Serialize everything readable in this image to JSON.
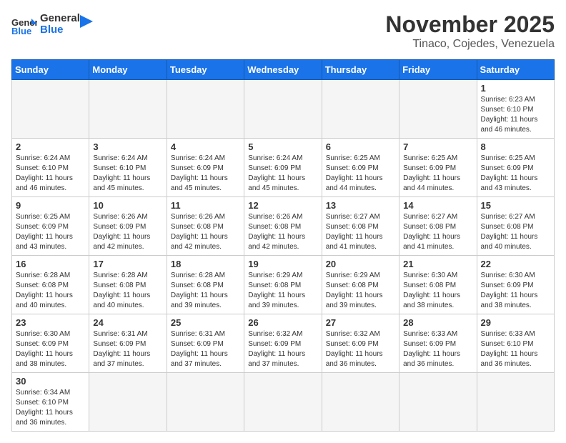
{
  "logo": {
    "text_general": "General",
    "text_blue": "Blue"
  },
  "header": {
    "month_title": "November 2025",
    "subtitle": "Tinaco, Cojedes, Venezuela"
  },
  "weekdays": [
    "Sunday",
    "Monday",
    "Tuesday",
    "Wednesday",
    "Thursday",
    "Friday",
    "Saturday"
  ],
  "weeks": [
    [
      {
        "day": "",
        "info": ""
      },
      {
        "day": "",
        "info": ""
      },
      {
        "day": "",
        "info": ""
      },
      {
        "day": "",
        "info": ""
      },
      {
        "day": "",
        "info": ""
      },
      {
        "day": "",
        "info": ""
      },
      {
        "day": "1",
        "info": "Sunrise: 6:23 AM\nSunset: 6:10 PM\nDaylight: 11 hours and 46 minutes."
      }
    ],
    [
      {
        "day": "2",
        "info": "Sunrise: 6:24 AM\nSunset: 6:10 PM\nDaylight: 11 hours and 46 minutes."
      },
      {
        "day": "3",
        "info": "Sunrise: 6:24 AM\nSunset: 6:10 PM\nDaylight: 11 hours and 45 minutes."
      },
      {
        "day": "4",
        "info": "Sunrise: 6:24 AM\nSunset: 6:09 PM\nDaylight: 11 hours and 45 minutes."
      },
      {
        "day": "5",
        "info": "Sunrise: 6:24 AM\nSunset: 6:09 PM\nDaylight: 11 hours and 45 minutes."
      },
      {
        "day": "6",
        "info": "Sunrise: 6:25 AM\nSunset: 6:09 PM\nDaylight: 11 hours and 44 minutes."
      },
      {
        "day": "7",
        "info": "Sunrise: 6:25 AM\nSunset: 6:09 PM\nDaylight: 11 hours and 44 minutes."
      },
      {
        "day": "8",
        "info": "Sunrise: 6:25 AM\nSunset: 6:09 PM\nDaylight: 11 hours and 43 minutes."
      }
    ],
    [
      {
        "day": "9",
        "info": "Sunrise: 6:25 AM\nSunset: 6:09 PM\nDaylight: 11 hours and 43 minutes."
      },
      {
        "day": "10",
        "info": "Sunrise: 6:26 AM\nSunset: 6:09 PM\nDaylight: 11 hours and 42 minutes."
      },
      {
        "day": "11",
        "info": "Sunrise: 6:26 AM\nSunset: 6:08 PM\nDaylight: 11 hours and 42 minutes."
      },
      {
        "day": "12",
        "info": "Sunrise: 6:26 AM\nSunset: 6:08 PM\nDaylight: 11 hours and 42 minutes."
      },
      {
        "day": "13",
        "info": "Sunrise: 6:27 AM\nSunset: 6:08 PM\nDaylight: 11 hours and 41 minutes."
      },
      {
        "day": "14",
        "info": "Sunrise: 6:27 AM\nSunset: 6:08 PM\nDaylight: 11 hours and 41 minutes."
      },
      {
        "day": "15",
        "info": "Sunrise: 6:27 AM\nSunset: 6:08 PM\nDaylight: 11 hours and 40 minutes."
      }
    ],
    [
      {
        "day": "16",
        "info": "Sunrise: 6:28 AM\nSunset: 6:08 PM\nDaylight: 11 hours and 40 minutes."
      },
      {
        "day": "17",
        "info": "Sunrise: 6:28 AM\nSunset: 6:08 PM\nDaylight: 11 hours and 40 minutes."
      },
      {
        "day": "18",
        "info": "Sunrise: 6:28 AM\nSunset: 6:08 PM\nDaylight: 11 hours and 39 minutes."
      },
      {
        "day": "19",
        "info": "Sunrise: 6:29 AM\nSunset: 6:08 PM\nDaylight: 11 hours and 39 minutes."
      },
      {
        "day": "20",
        "info": "Sunrise: 6:29 AM\nSunset: 6:08 PM\nDaylight: 11 hours and 39 minutes."
      },
      {
        "day": "21",
        "info": "Sunrise: 6:30 AM\nSunset: 6:08 PM\nDaylight: 11 hours and 38 minutes."
      },
      {
        "day": "22",
        "info": "Sunrise: 6:30 AM\nSunset: 6:09 PM\nDaylight: 11 hours and 38 minutes."
      }
    ],
    [
      {
        "day": "23",
        "info": "Sunrise: 6:30 AM\nSunset: 6:09 PM\nDaylight: 11 hours and 38 minutes."
      },
      {
        "day": "24",
        "info": "Sunrise: 6:31 AM\nSunset: 6:09 PM\nDaylight: 11 hours and 37 minutes."
      },
      {
        "day": "25",
        "info": "Sunrise: 6:31 AM\nSunset: 6:09 PM\nDaylight: 11 hours and 37 minutes."
      },
      {
        "day": "26",
        "info": "Sunrise: 6:32 AM\nSunset: 6:09 PM\nDaylight: 11 hours and 37 minutes."
      },
      {
        "day": "27",
        "info": "Sunrise: 6:32 AM\nSunset: 6:09 PM\nDaylight: 11 hours and 36 minutes."
      },
      {
        "day": "28",
        "info": "Sunrise: 6:33 AM\nSunset: 6:09 PM\nDaylight: 11 hours and 36 minutes."
      },
      {
        "day": "29",
        "info": "Sunrise: 6:33 AM\nSunset: 6:10 PM\nDaylight: 11 hours and 36 minutes."
      }
    ],
    [
      {
        "day": "30",
        "info": "Sunrise: 6:34 AM\nSunset: 6:10 PM\nDaylight: 11 hours and 36 minutes."
      },
      {
        "day": "",
        "info": ""
      },
      {
        "day": "",
        "info": ""
      },
      {
        "day": "",
        "info": ""
      },
      {
        "day": "",
        "info": ""
      },
      {
        "day": "",
        "info": ""
      },
      {
        "day": "",
        "info": ""
      }
    ]
  ]
}
